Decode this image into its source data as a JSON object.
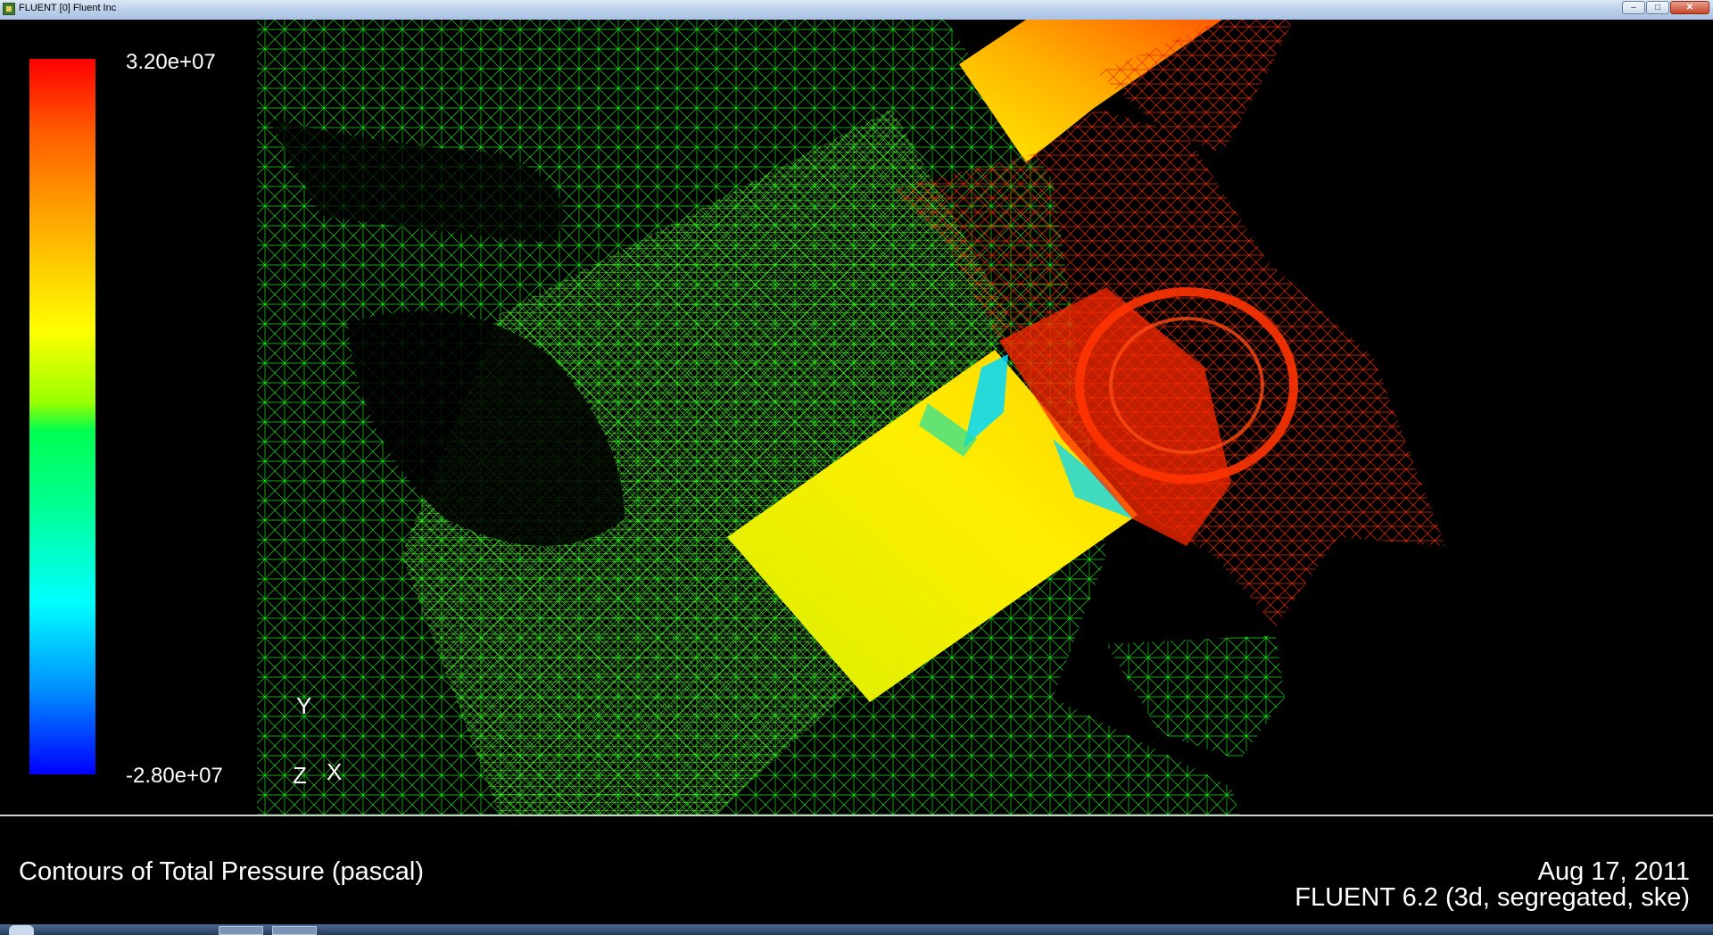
{
  "window": {
    "title": "FLUENT [0] Fluent Inc",
    "controls": {
      "minimize": "–",
      "maximize": "□",
      "close": "✕"
    }
  },
  "colorbar": {
    "max_label": "3.20e+07",
    "min_label": "-2.80e+07",
    "colormap": [
      "#ff0000",
      "#ffa500",
      "#ffff00",
      "#00ff50",
      "#00ffff",
      "#0000ff"
    ]
  },
  "axes": {
    "y": "Y",
    "z": "Z",
    "x": "X"
  },
  "caption": {
    "title": "Contours of Total Pressure (pascal)",
    "date": "Aug 17, 2011",
    "version": "FLUENT 6.2 (3d, segregated, ske)"
  },
  "colors": {
    "mesh_green": "#22dd22",
    "mesh_red": "#ee2200",
    "background": "#000000"
  }
}
